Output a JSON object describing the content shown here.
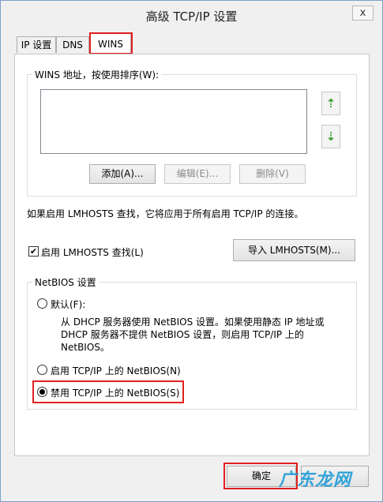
{
  "window": {
    "title": "高级 TCP/IP 设置",
    "close_label": "x"
  },
  "tabs": [
    {
      "label": "IP 设置"
    },
    {
      "label": "DNS"
    },
    {
      "label": "WINS"
    }
  ],
  "wins": {
    "group_title": "WINS 地址，按使用排序(W):",
    "up_glyph": "⇡",
    "down_glyph": "⇣",
    "add_label": "添加(A)...",
    "edit_label": "编辑(E)...",
    "remove_label": "删除(V)"
  },
  "lmhosts": {
    "info_text": "如果启用 LMHOSTS 查找，它将应用于所有启用 TCP/IP 的连接。",
    "checkbox_label": "启用 LMHOSTS 查找(L)",
    "checkbox_checked": true,
    "checkmark": "✔",
    "import_label": "导入 LMHOSTS(M)..."
  },
  "netbios": {
    "group_title": "NetBIOS 设置",
    "default_label": "默认(F):",
    "default_desc_1": "从 DHCP 服务器使用 NetBIOS 设置。如果使用静态 IP 地址或",
    "default_desc_2": "DHCP 服务器不提供 NetBIOS 设置，则启用 TCP/IP 上的",
    "default_desc_3": "NetBIOS。",
    "enable_label": "启用 TCP/IP 上的 NetBIOS(N)",
    "disable_label": "禁用 TCP/IP 上的 NetBIOS(S)",
    "selected": "disable"
  },
  "footer": {
    "ok_label": "确定"
  },
  "watermark": "广东龙网",
  "colors": {
    "highlight": "#e02020",
    "arrow": "#3a9a2e",
    "watermark": "#1e9bd7"
  }
}
